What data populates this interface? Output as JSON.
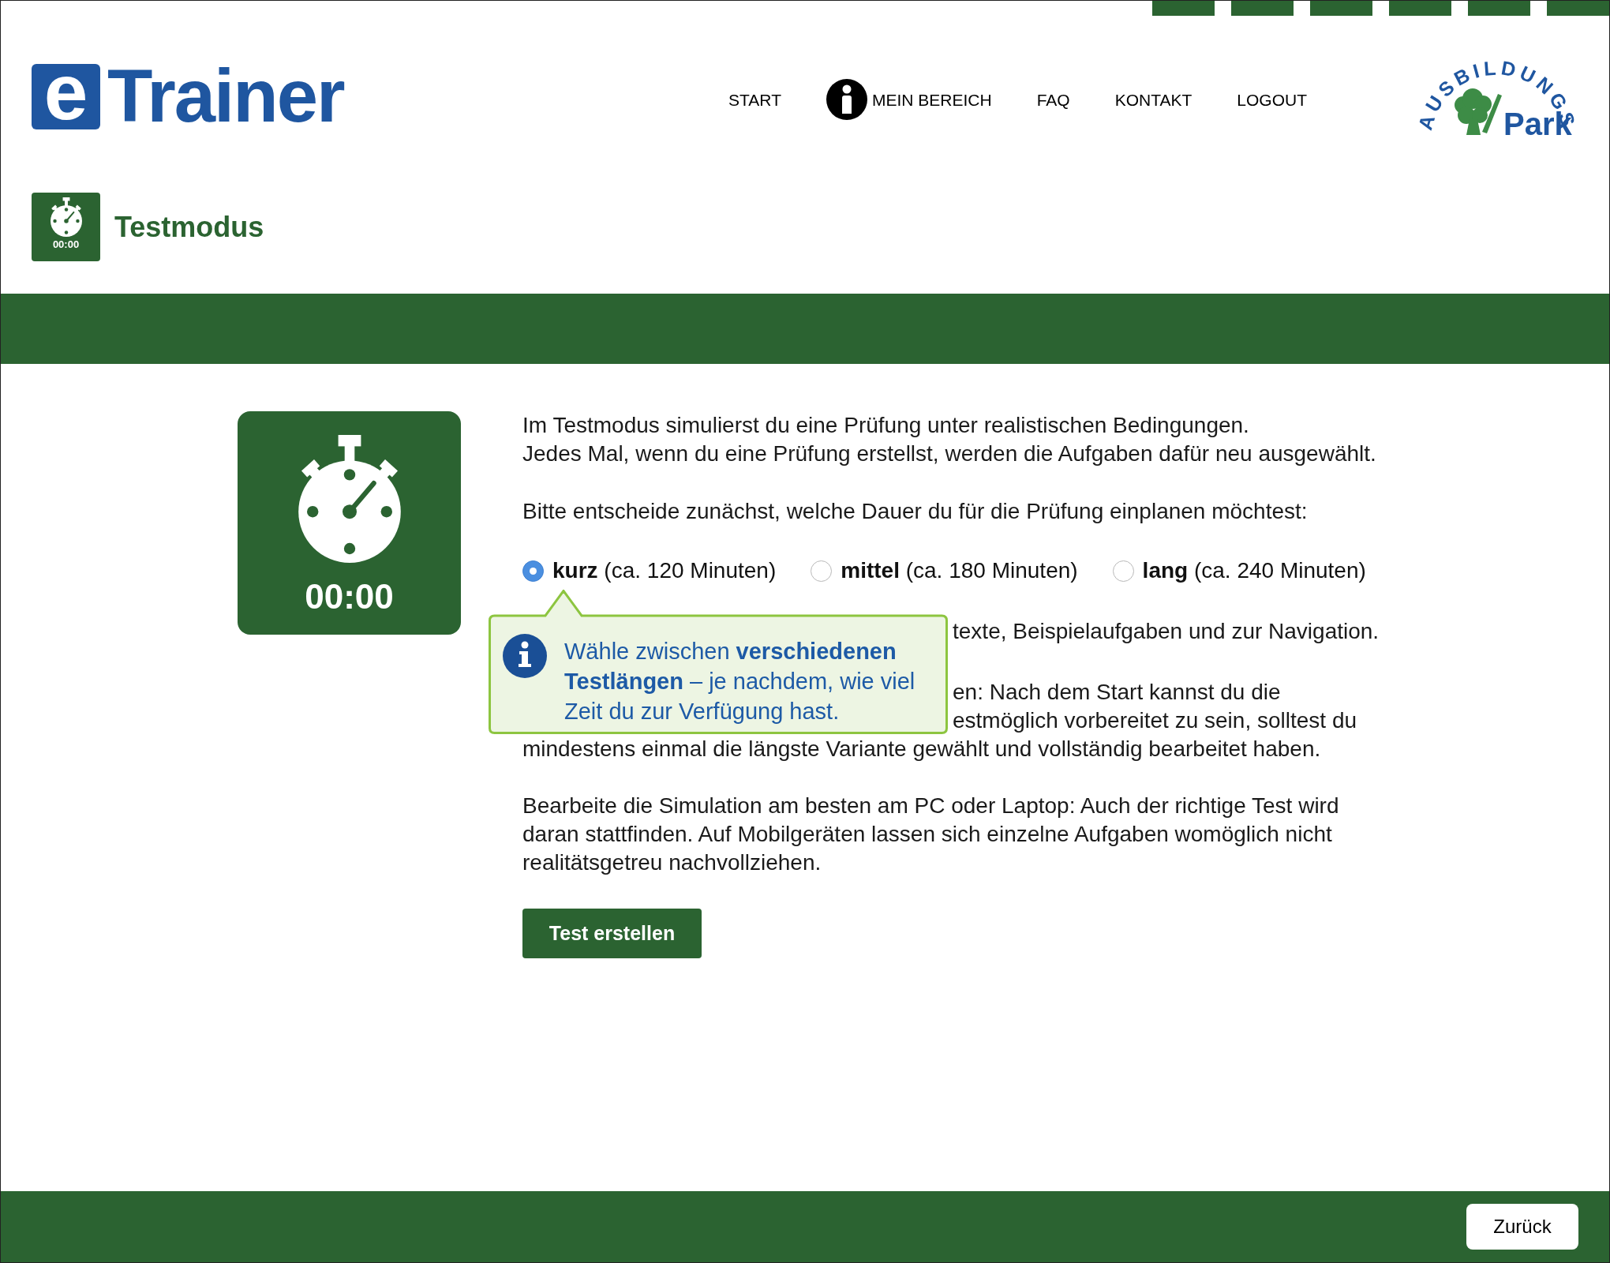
{
  "header": {
    "logo": {
      "badge": "e",
      "wordmark": "Trainer"
    },
    "nav": [
      {
        "label": "START",
        "kind": "text"
      },
      {
        "label": "MEIN BEREICH",
        "kind": "info"
      },
      {
        "label": "FAQ",
        "kind": "text"
      },
      {
        "label": "KONTAKT",
        "kind": "text"
      },
      {
        "label": "LOGOUT",
        "kind": "text"
      }
    ],
    "partner_logo": {
      "arc_text": "AUSBILDUNGS",
      "wordmark": "Park"
    }
  },
  "page_title": {
    "text": "Testmodus",
    "icon_time": "00:00"
  },
  "timer_card": {
    "time": "00:00"
  },
  "content": {
    "intro": [
      "Im Testmodus simulierst du eine Prüfung unter realistischen Bedingungen.",
      "Jedes Mal, wenn du eine Prüfung erstellst, werden die Aufgaben dafür neu ausgewählt."
    ],
    "prompt": "Bitte entscheide zunächst, welche Dauer du für die Prüfung einplanen möchtest:",
    "durations": [
      {
        "label": "**kurz** (ca. 120 Minuten)",
        "selected": true
      },
      {
        "label": "**mittel** (ca. 180 Minuten)",
        "selected": false
      },
      {
        "label": "**lang** (ca. 240 Minuten)",
        "selected": false
      }
    ],
    "covered_paragraphs": [
      {
        "lines": [
          {
            "text": "texte, Beispielaufgaben und zur Navigation.",
            "clipped": true
          }
        ]
      },
      {
        "lines": [
          {
            "text": "en: Nach dem Start kannst du die",
            "clipped": true
          },
          {
            "text": "estmöglich vorbereitet zu sein, solltest du",
            "clipped": true
          },
          {
            "text": "mindestens einmal die längste Variante gewählt und vollständig bearbeitet haben.",
            "clipped": false
          }
        ]
      }
    ],
    "outro": [
      "Bearbeite die Simulation am besten am PC oder Laptop: Auch der richtige Test wird",
      "daran stattfinden. Auf Mobilgeräten lassen sich einzelne Aufgaben womöglich nicht",
      "realitätsgetreu nachvollziehen."
    ],
    "primary_button": "Test erstellen"
  },
  "tooltip": {
    "lines": [
      "Wähle zwischen **verschiedenen**",
      "**Testlängen** – je nachdem, wie viel",
      "Zeit du zur Verfügung hast."
    ]
  },
  "footer": {
    "back_button": "Zurück"
  }
}
